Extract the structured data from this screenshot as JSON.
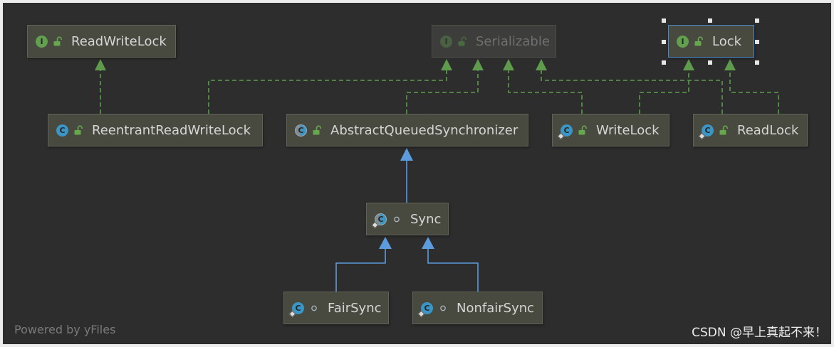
{
  "nodes": [
    {
      "label": "ReadWriteLock",
      "icon": "interface-icon",
      "icon_letter": "I",
      "visibility_icon": "public-lock-icon"
    },
    {
      "label": "Serializable",
      "icon": "interface-icon",
      "icon_letter": "I",
      "visibility_icon": "public-lock-icon",
      "dimmed": true
    },
    {
      "label": "Lock",
      "icon": "interface-icon",
      "icon_letter": "I",
      "visibility_icon": "public-lock-icon",
      "selected": true
    },
    {
      "label": "ReentrantReadWriteLock",
      "icon": "class-icon",
      "icon_letter": "C",
      "visibility_icon": "public-lock-icon"
    },
    {
      "label": "AbstractQueuedSynchronizer",
      "icon": "abstract-class-icon",
      "icon_letter": "C",
      "visibility_icon": "public-lock-icon"
    },
    {
      "label": "WriteLock",
      "icon": "inner-class-icon",
      "icon_letter": "C",
      "visibility_icon": "public-lock-icon"
    },
    {
      "label": "ReadLock",
      "icon": "inner-class-icon",
      "icon_letter": "C",
      "visibility_icon": "public-lock-icon"
    },
    {
      "label": "Sync",
      "icon": "abstract-inner-class-icon",
      "icon_letter": "C",
      "visibility_icon": "package-private-icon"
    },
    {
      "label": "FairSync",
      "icon": "inner-class-icon",
      "icon_letter": "C",
      "visibility_icon": "package-private-icon"
    },
    {
      "label": "NonfairSync",
      "icon": "inner-class-icon",
      "icon_letter": "C",
      "visibility_icon": "package-private-icon"
    }
  ],
  "footer": {
    "watermark": "Powered by yFiles",
    "credit": "CSDN @早上真起不来！"
  },
  "colors": {
    "background": "#2d2d2d",
    "node_fill": "#494a3f",
    "implements_edge": "#5f9b4c",
    "extends_edge": "#5c9bdc",
    "selection": "#4a88c7"
  }
}
